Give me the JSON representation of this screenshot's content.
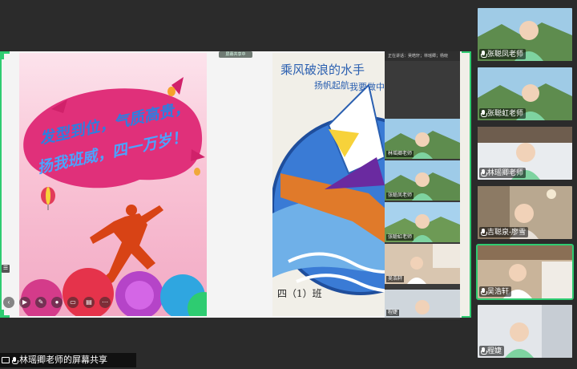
{
  "share": {
    "toolbar_chip": "屏幕共享中",
    "bottom_label": "林瑶卿老师的屏幕共享"
  },
  "poster": {
    "line1": "发型到位，气质高贵，",
    "line2": "扬我班威，四一万岁！"
  },
  "drawing": {
    "line1": "乘风破浪的水手",
    "line2": "扬帆起航",
    "line3": "我要做中国好少年",
    "signature": "四（1）班"
  },
  "float_gallery": {
    "header": "正在讲话：吴皓轩；林瑶卿；杨晓",
    "tiles": [
      {
        "label": "林瑶卿老师"
      },
      {
        "label": "张聪凤老师"
      },
      {
        "label": "张聪虹老师"
      },
      {
        "label": "吴浩轩"
      },
      {
        "label": "程婕"
      }
    ]
  },
  "participants": [
    {
      "name": "张聪凤老师",
      "active": false
    },
    {
      "name": "张聪虹老师",
      "active": false
    },
    {
      "name": "林瑶卿老师",
      "active": false
    },
    {
      "name": "吉聪泉-廖雪",
      "active": false
    },
    {
      "name": "吴浩轩",
      "active": true
    },
    {
      "name": "程婕",
      "active": false
    }
  ],
  "colors": {
    "active_border": "#2ecc71",
    "background": "#2b2b2b"
  }
}
